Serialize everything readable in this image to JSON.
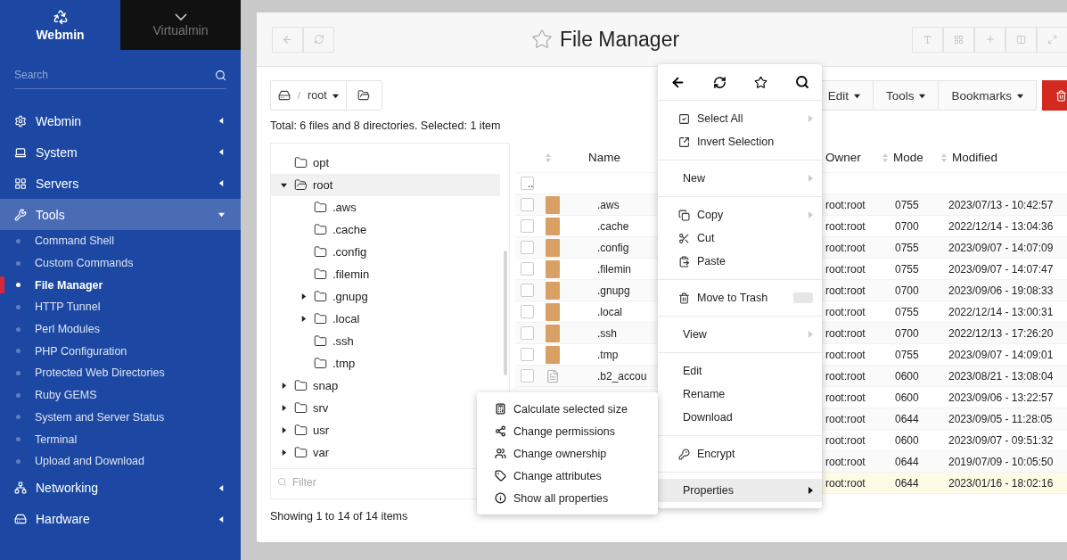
{
  "sidebar": {
    "switcher": [
      {
        "label": "Webmin",
        "selected": true
      },
      {
        "label": "Virtualmin",
        "selected": false
      }
    ],
    "search": {
      "placeholder": "Search"
    },
    "menu": [
      {
        "label": "Webmin",
        "expanded": false
      },
      {
        "label": "System",
        "expanded": false
      },
      {
        "label": "Servers",
        "expanded": false
      },
      {
        "label": "Tools",
        "expanded": true,
        "children": [
          {
            "label": "Command Shell",
            "selected": false
          },
          {
            "label": "Custom Commands",
            "selected": false
          },
          {
            "label": "File Manager",
            "selected": true
          },
          {
            "label": "HTTP Tunnel",
            "selected": false
          },
          {
            "label": "Perl Modules",
            "selected": false
          },
          {
            "label": "PHP Configuration",
            "selected": false
          },
          {
            "label": "Protected Web Directories",
            "selected": false
          },
          {
            "label": "Ruby GEMS",
            "selected": false
          },
          {
            "label": "System and Server Status",
            "selected": false
          },
          {
            "label": "Terminal",
            "selected": false
          },
          {
            "label": "Upload and Download",
            "selected": false
          }
        ]
      },
      {
        "label": "Networking",
        "expanded": false
      },
      {
        "label": "Hardware",
        "expanded": false
      }
    ]
  },
  "header": {
    "title": "File Manager"
  },
  "breadcrumb": {
    "path": [
      "/",
      "root"
    ]
  },
  "toolbar": [
    {
      "label": "Edit"
    },
    {
      "label": "Tools"
    },
    {
      "label": "Bookmarks"
    }
  ],
  "summary": "Total: 6 files and 8 directories. Selected: 1 item",
  "tree": {
    "items": [
      {
        "label": "opt",
        "expandable": false,
        "expanded": false,
        "selected": false
      },
      {
        "label": "root",
        "expandable": true,
        "expanded": true,
        "selected": true,
        "children": [
          {
            "label": ".aws",
            "expandable": false,
            "expanded": false,
            "selected": false
          },
          {
            "label": ".cache",
            "expandable": false,
            "expanded": false,
            "selected": false
          },
          {
            "label": ".config",
            "expandable": false,
            "expanded": false,
            "selected": false
          },
          {
            "label": ".filemin",
            "expandable": false,
            "expanded": false,
            "selected": false
          },
          {
            "label": ".gnupg",
            "expandable": true,
            "expanded": false,
            "selected": false
          },
          {
            "label": ".local",
            "expandable": true,
            "expanded": false,
            "selected": false
          },
          {
            "label": ".ssh",
            "expandable": false,
            "expanded": false,
            "selected": false
          },
          {
            "label": ".tmp",
            "expandable": false,
            "expanded": false,
            "selected": false
          }
        ]
      },
      {
        "label": "snap",
        "expandable": true,
        "expanded": false,
        "selected": false
      },
      {
        "label": "srv",
        "expandable": true,
        "expanded": false,
        "selected": false
      },
      {
        "label": "usr",
        "expandable": true,
        "expanded": false,
        "selected": false
      },
      {
        "label": "var",
        "expandable": true,
        "expanded": false,
        "selected": false
      }
    ],
    "filter": {
      "placeholder": "Filter"
    }
  },
  "table": {
    "columns": [
      "Name",
      "Owner",
      "Mode",
      "Modified"
    ],
    "parent_row": {
      "name": "..",
      "checked": false
    },
    "rows": [
      {
        "kind": "folder",
        "checked": false,
        "name": ".aws",
        "owner": "root:root",
        "mode": "0755",
        "modified": "2023/07/13 - 10:42:57",
        "selected": false
      },
      {
        "kind": "folder",
        "checked": false,
        "name": ".cache",
        "owner": "root:root",
        "mode": "0700",
        "modified": "2022/12/14 - 13:04:36",
        "selected": false
      },
      {
        "kind": "folder",
        "checked": false,
        "name": ".config",
        "owner": "root:root",
        "mode": "0755",
        "modified": "2023/09/07 - 14:07:09",
        "selected": false
      },
      {
        "kind": "folder",
        "checked": false,
        "name": ".filemin",
        "owner": "root:root",
        "mode": "0755",
        "modified": "2023/09/07 - 14:07:47",
        "selected": false
      },
      {
        "kind": "folder",
        "checked": false,
        "name": ".gnupg",
        "owner": "root:root",
        "mode": "0700",
        "modified": "2023/09/06 - 19:08:33",
        "selected": false
      },
      {
        "kind": "folder",
        "checked": false,
        "name": ".local",
        "owner": "root:root",
        "mode": "0755",
        "modified": "2022/12/14 - 13:00:31",
        "selected": false
      },
      {
        "kind": "folder",
        "checked": false,
        "name": ".ssh",
        "owner": "root:root",
        "mode": "0700",
        "modified": "2022/12/13 - 17:26:20",
        "selected": false
      },
      {
        "kind": "folder",
        "checked": false,
        "name": ".tmp",
        "owner": "root:root",
        "mode": "0755",
        "modified": "2023/09/07 - 14:09:01",
        "selected": false
      },
      {
        "kind": "file",
        "checked": false,
        "name": ".b2_accou",
        "owner": "root:root",
        "mode": "0600",
        "modified": "2023/08/21 - 13:08:04",
        "selected": false
      },
      {
        "owner": "root:root",
        "mode": "0600",
        "modified": "2023/09/06 - 13:22:57",
        "selected": false
      },
      {
        "owner": "root:root",
        "mode": "0644",
        "modified": "2023/09/05 - 11:28:05",
        "selected": false
      },
      {
        "owner": "root:root",
        "mode": "0600",
        "modified": "2023/09/07 - 09:51:32",
        "selected": false
      },
      {
        "owner": "root:root",
        "mode": "0644",
        "modified": "2019/07/09 - 10:05:50",
        "selected": false
      },
      {
        "owner": "root:root",
        "mode": "0644",
        "modified": "2023/01/16 - 18:02:16",
        "selected": true
      }
    ]
  },
  "footer": "Showing 1 to 14 of 14 items",
  "context_menu": {
    "groups": [
      [
        {
          "label": "Select All",
          "submenu": true,
          "highlighted": false
        },
        {
          "label": "Invert Selection",
          "submenu": false,
          "highlighted": false
        }
      ],
      [
        {
          "label": "New",
          "submenu": true,
          "highlighted": false
        }
      ],
      [
        {
          "label": "Copy",
          "submenu": true,
          "highlighted": false
        },
        {
          "label": "Cut",
          "submenu": false,
          "highlighted": false
        },
        {
          "label": "Paste",
          "submenu": false,
          "highlighted": false
        }
      ],
      [
        {
          "label": "Move to Trash",
          "submenu": false,
          "highlighted": false
        }
      ],
      [
        {
          "label": "View",
          "submenu": true,
          "highlighted": false
        }
      ],
      [
        {
          "label": "Edit",
          "submenu": false,
          "highlighted": false
        },
        {
          "label": "Rename",
          "submenu": false,
          "highlighted": false
        },
        {
          "label": "Download",
          "submenu": false,
          "highlighted": false
        }
      ],
      [
        {
          "label": "Encrypt",
          "submenu": false,
          "highlighted": false
        }
      ],
      [
        {
          "label": "Properties",
          "submenu": true,
          "highlighted": true
        }
      ]
    ]
  },
  "submenu": {
    "items": [
      {
        "label": "Calculate selected size"
      },
      {
        "label": "Change permissions"
      },
      {
        "label": "Change ownership"
      },
      {
        "label": "Change attributes"
      },
      {
        "label": "Show all properties"
      }
    ]
  }
}
